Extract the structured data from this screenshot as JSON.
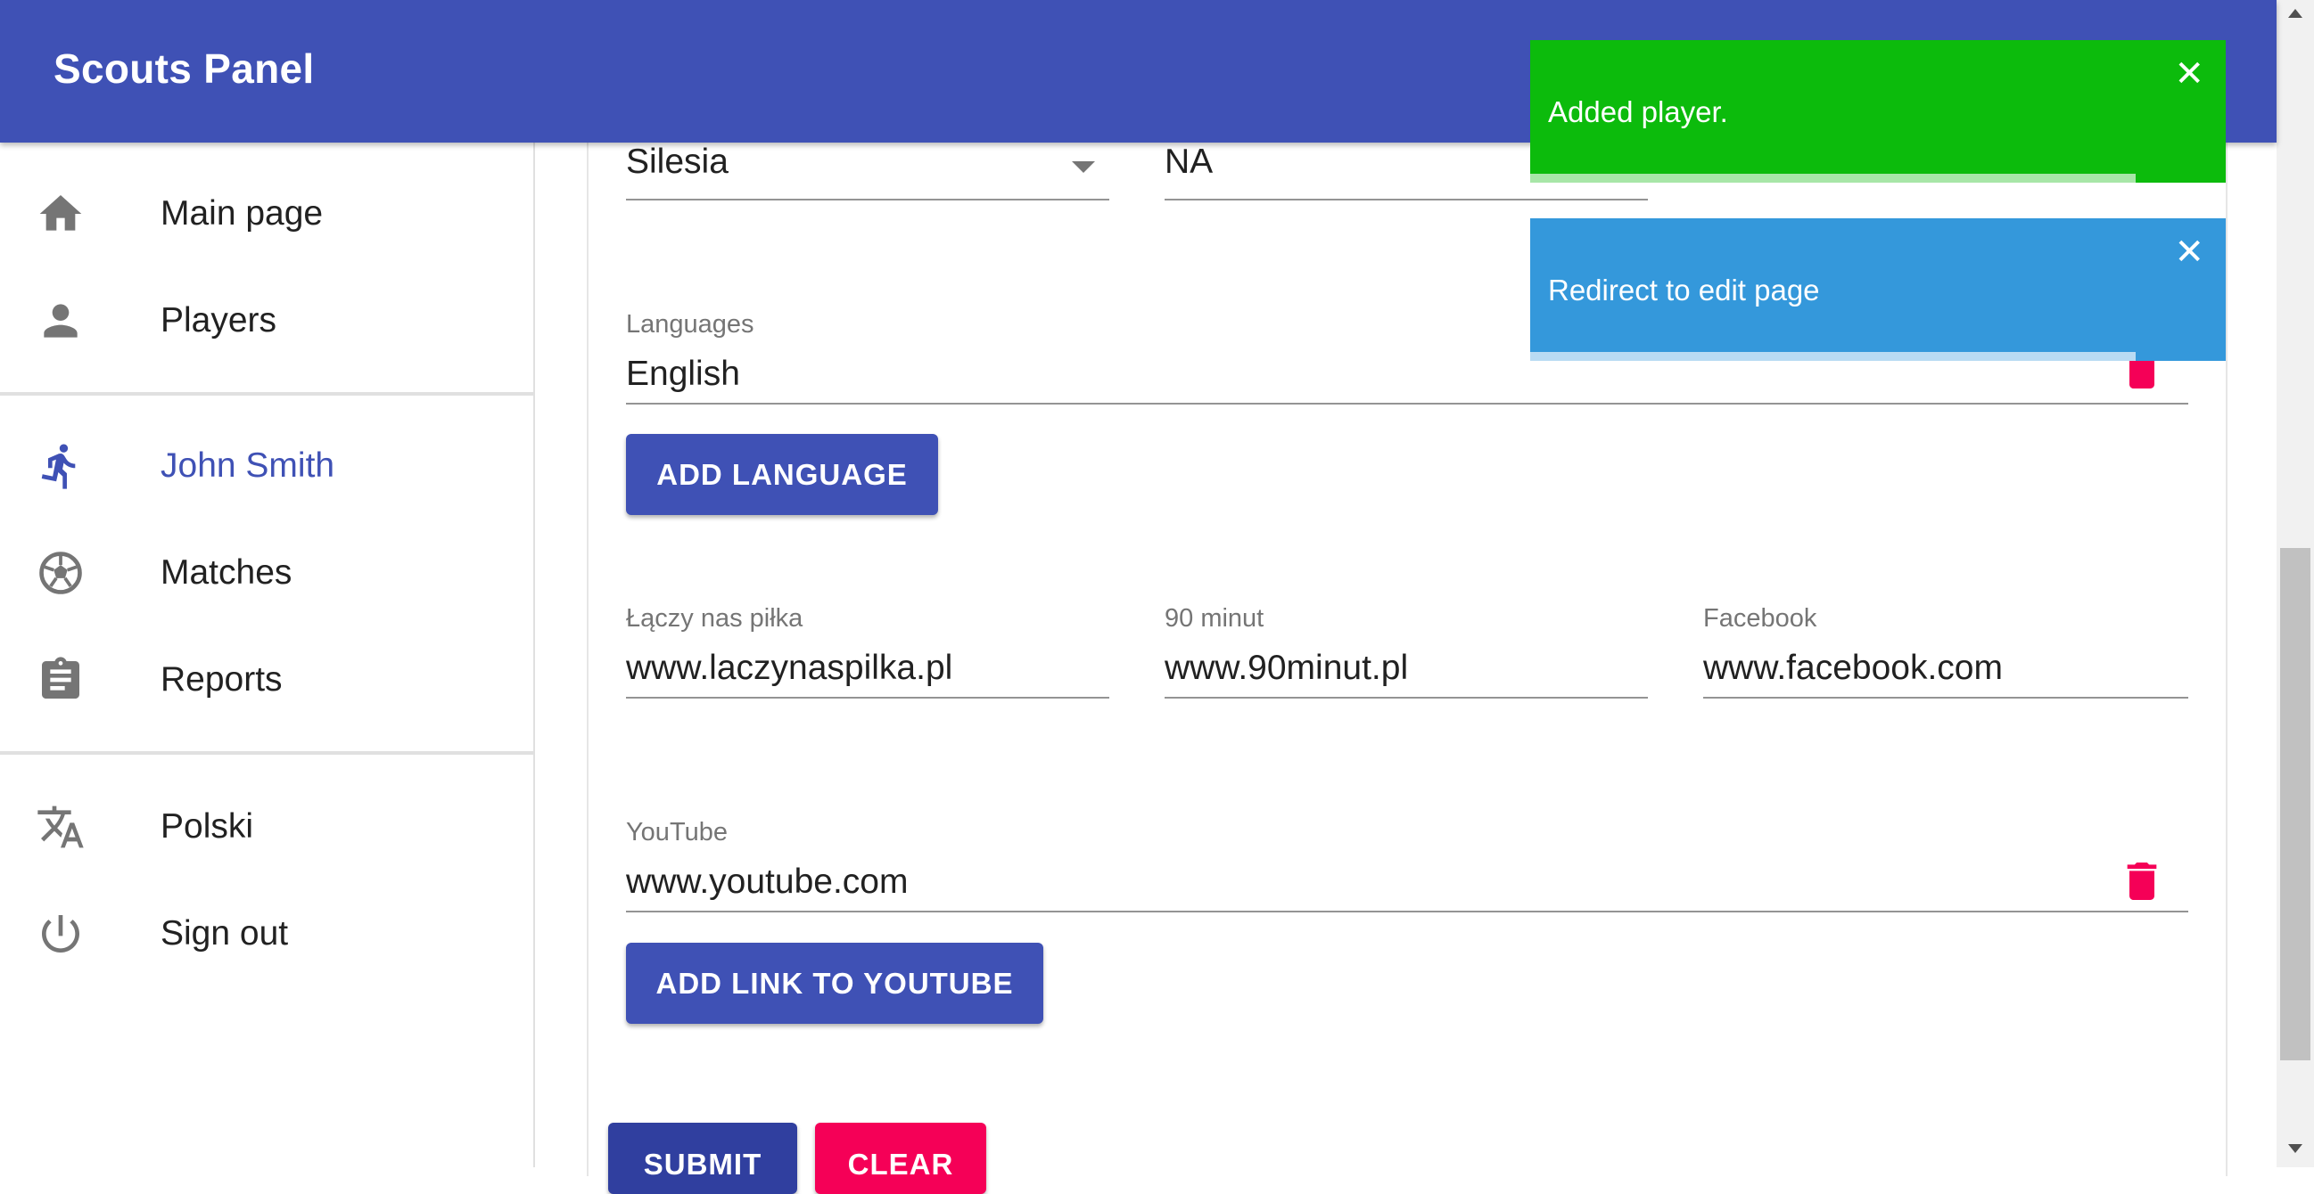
{
  "app": {
    "title": "Scouts Panel"
  },
  "sidebar": {
    "items": [
      {
        "label": "Main page",
        "icon": "home-icon"
      },
      {
        "label": "Players",
        "icon": "person-icon"
      },
      {
        "label": "John Smith",
        "icon": "running-person-icon",
        "active": true
      },
      {
        "label": "Matches",
        "icon": "soccer-ball-icon"
      },
      {
        "label": "Reports",
        "icon": "clipboard-icon"
      },
      {
        "label": "Polski",
        "icon": "translate-icon"
      },
      {
        "label": "Sign out",
        "icon": "power-icon"
      }
    ]
  },
  "form": {
    "region_select": {
      "value": "Silesia"
    },
    "top_field": {
      "value": "NA"
    },
    "languages": {
      "label": "Languages",
      "value": "English"
    },
    "add_language_button": "ADD LANGUAGE",
    "laczy_nas_pilka": {
      "label": "Łączy nas piłka",
      "value": "www.laczynaspilka.pl"
    },
    "minut90": {
      "label": "90 minut",
      "value": "www.90minut.pl"
    },
    "facebook": {
      "label": "Facebook",
      "value": "www.facebook.com"
    },
    "youtube": {
      "label": "YouTube",
      "value": "www.youtube.com"
    },
    "add_youtube_button": "ADD LINK TO YOUTUBE",
    "submit_button": "SUBMIT",
    "clear_button": "CLEAR"
  },
  "toasts": [
    {
      "message": "Added player.",
      "close": "✕",
      "color": "#0cbb0c",
      "progress": 0.87
    },
    {
      "message": "Redirect to edit page",
      "close": "✕",
      "color": "#3498db",
      "progress": 0.87
    }
  ],
  "colors": {
    "primary": "#3f51b5",
    "secondary": "#f50057",
    "success": "#0cbb0c",
    "info": "#3498db"
  }
}
